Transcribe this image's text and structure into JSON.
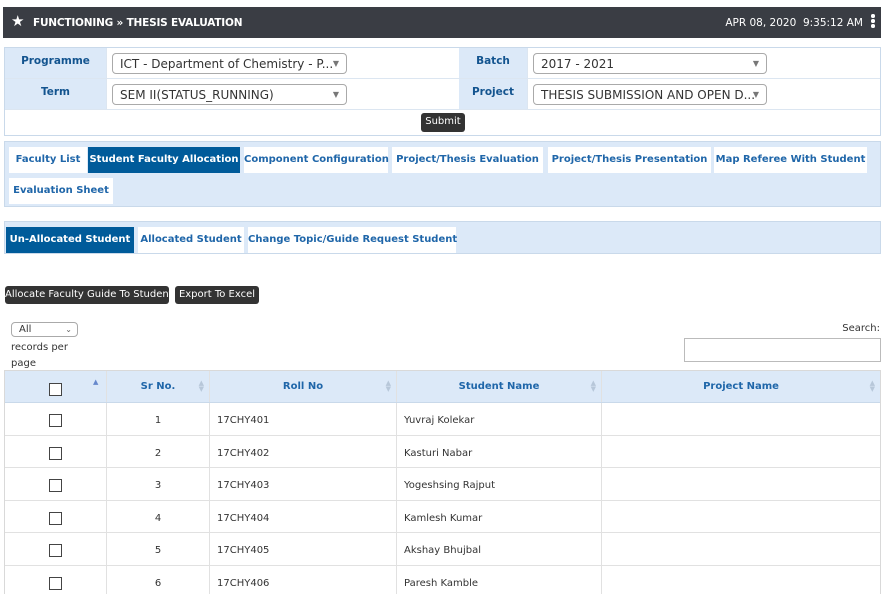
{
  "header": {
    "title": "FUNCTIONING » THESIS EVALUATION",
    "date": "APR 08, 2020",
    "time": "9:35:12 AM"
  },
  "filters": {
    "programme_label": "Programme",
    "programme_value": "ICT - Department of Chemistry - P...",
    "batch_label": "Batch",
    "batch_value": "2017 - 2021",
    "term_label": "Term",
    "term_value": "SEM II(STATUS_RUNNING)",
    "project_label": "Project",
    "project_value": "THESIS SUBMISSION AND OPEN D...",
    "submit_label": "Submit"
  },
  "tabs": [
    {
      "label": "Faculty List",
      "active": false
    },
    {
      "label": "Student Faculty Allocation",
      "active": true
    },
    {
      "label": "Component Configuration",
      "active": false
    },
    {
      "label": "Project/Thesis Evaluation",
      "active": false
    },
    {
      "label": "Project/Thesis Presentation",
      "active": false
    },
    {
      "label": "Map Referee With Student",
      "active": false
    },
    {
      "label": "Evaluation Sheet",
      "active": false
    }
  ],
  "subtabs": [
    {
      "label": "Un-Allocated Student",
      "active": true
    },
    {
      "label": "Allocated Student",
      "active": false
    },
    {
      "label": "Change Topic/Guide Request Student",
      "active": false
    }
  ],
  "actions": {
    "allocate_label": "Allocate Faculty Guide To Student",
    "export_label": "Export To Excel"
  },
  "table_controls": {
    "length_value": "All",
    "length_text": "records per page",
    "search_label": "Search:"
  },
  "table": {
    "columns": [
      "Sr No.",
      "Roll No",
      "Student Name",
      "Project Name"
    ],
    "rows": [
      {
        "sr": "1",
        "roll": "17CHY401",
        "name": "Yuvraj Kolekar",
        "project": ""
      },
      {
        "sr": "2",
        "roll": "17CHY402",
        "name": "Kasturi Nabar",
        "project": ""
      },
      {
        "sr": "3",
        "roll": "17CHY403",
        "name": "Yogeshsing Rajput",
        "project": ""
      },
      {
        "sr": "4",
        "roll": "17CHY404",
        "name": "Kamlesh Kumar",
        "project": ""
      },
      {
        "sr": "5",
        "roll": "17CHY405",
        "name": "Akshay Bhujbal",
        "project": ""
      },
      {
        "sr": "6",
        "roll": "17CHY406",
        "name": "Paresh Kamble",
        "project": ""
      }
    ]
  },
  "colors": {
    "topbar": "#3a3d44",
    "accent": "#005b9a",
    "label_bg": "#dce9f8",
    "label_text": "#13548f"
  },
  "icons": {
    "header": "star-icon",
    "menu": "kebab-menu-icon",
    "dropdown": "chevron-down-icon",
    "sort": "sort-icon"
  }
}
